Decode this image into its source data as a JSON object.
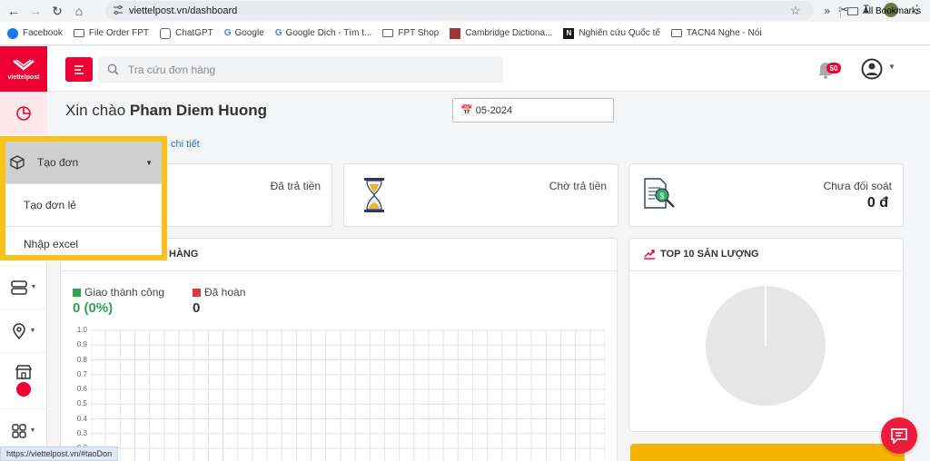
{
  "browser": {
    "url": "viettelpost.vn/dashboard",
    "bookmarks": [
      "Facebook",
      "File Order FPT",
      "ChatGPT",
      "Google",
      "Google Dịch - Tìm t...",
      "FPT Shop",
      "Cambridge Dictiona...",
      "Nghiên cứu Quốc tế",
      "TACN4 Nghe - Nói"
    ],
    "all_bookmarks": "All Bookmarks",
    "more": "»",
    "status_url": "https://viettelpost.vn/#taoDon"
  },
  "app": {
    "logo_text": "viettelpost",
    "accent": "#ee0033",
    "search_placeholder": "Tra cứu đơn hàng",
    "notification_count": "50"
  },
  "main": {
    "greeting": "Xin chào",
    "user_name": "Pham Diem Huong",
    "month": "05-2024",
    "detail_link": "chi tiết"
  },
  "cards": [
    {
      "label": "Đã trả tiền",
      "value": ""
    },
    {
      "label": "Chờ trả tiền",
      "value": ""
    },
    {
      "label": "Chưa đối soát",
      "value": "0 đ"
    }
  ],
  "orders_panel": {
    "title": "HÀNG",
    "legend": [
      {
        "label": "Giao thành công",
        "value": "0 (0%)",
        "color": "#2ea44f"
      },
      {
        "label": "Đã hoàn",
        "value": "0",
        "color": "#d83a3a"
      }
    ],
    "y_ticks": [
      "1.0",
      "0.9",
      "0.8",
      "0.7",
      "0.6",
      "0.5",
      "0.4",
      "0.3",
      "0.2"
    ]
  },
  "top_panel": {
    "title": "TOP 10 SẢN LƯỢNG"
  },
  "dropdown": {
    "header": "Tạo đơn",
    "items": [
      "Tạo đơn lẻ",
      "Nhập excel"
    ]
  },
  "chart_data": {
    "type": "line",
    "title": "",
    "x": [],
    "series": [
      {
        "name": "Giao thành công",
        "values": []
      },
      {
        "name": "Đã hoàn",
        "values": []
      }
    ],
    "ylim": [
      0,
      1.0
    ],
    "grid": true,
    "y_tick_labels": [
      "1.0",
      "0.9",
      "0.8",
      "0.7",
      "0.6",
      "0.5",
      "0.4",
      "0.3",
      "0.2"
    ]
  }
}
